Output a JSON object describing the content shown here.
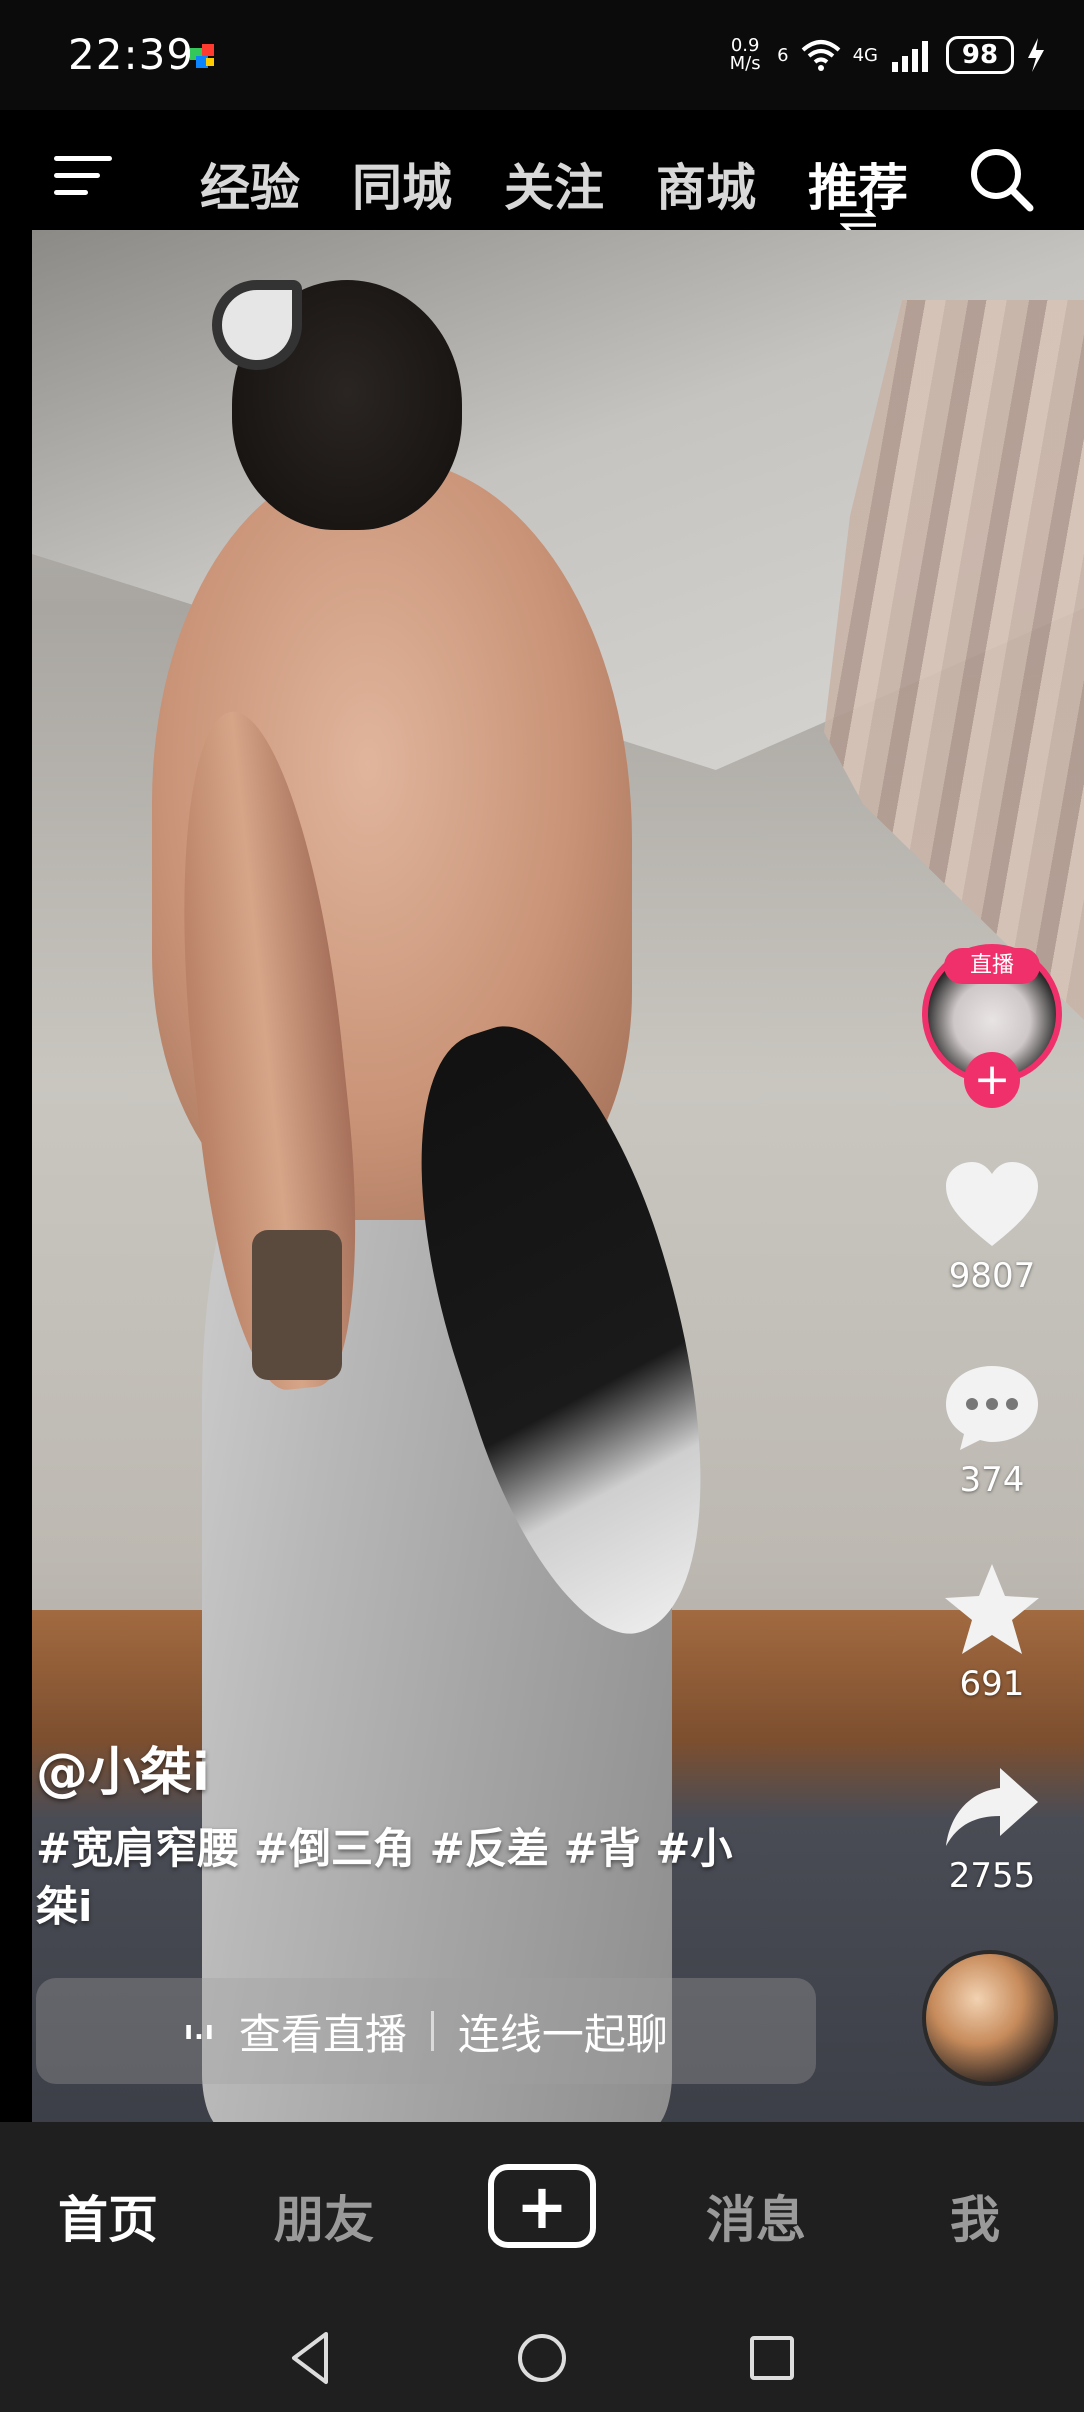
{
  "status_bar": {
    "time": "22:39",
    "net_speed_top": "0.9",
    "net_speed_bottom": "M/s",
    "wifi_label": "6",
    "cell_label": "4G",
    "battery": "98"
  },
  "top_nav": {
    "tabs": [
      {
        "label": "经验"
      },
      {
        "label": "同城"
      },
      {
        "label": "关注"
      },
      {
        "label": "商城"
      },
      {
        "label": "推荐",
        "active": true
      }
    ]
  },
  "video": {
    "live_badge": "直播",
    "actions": {
      "likes": "9807",
      "comments": "374",
      "favorites": "691",
      "shares": "2755"
    },
    "author": "@小桀i",
    "caption": "#宽肩窄腰 #倒三角 #反差 #背 #小桀i",
    "live_strip": {
      "left": "查看直播",
      "right": "连线一起聊"
    }
  },
  "bottom_nav": {
    "home": "首页",
    "friends": "朋友",
    "create": "+",
    "messages": "消息",
    "me": "我"
  },
  "colors": {
    "accent": "#f0306a",
    "bottom_bg": "#1f1f1f",
    "inactive_text": "#9a9a9a"
  }
}
